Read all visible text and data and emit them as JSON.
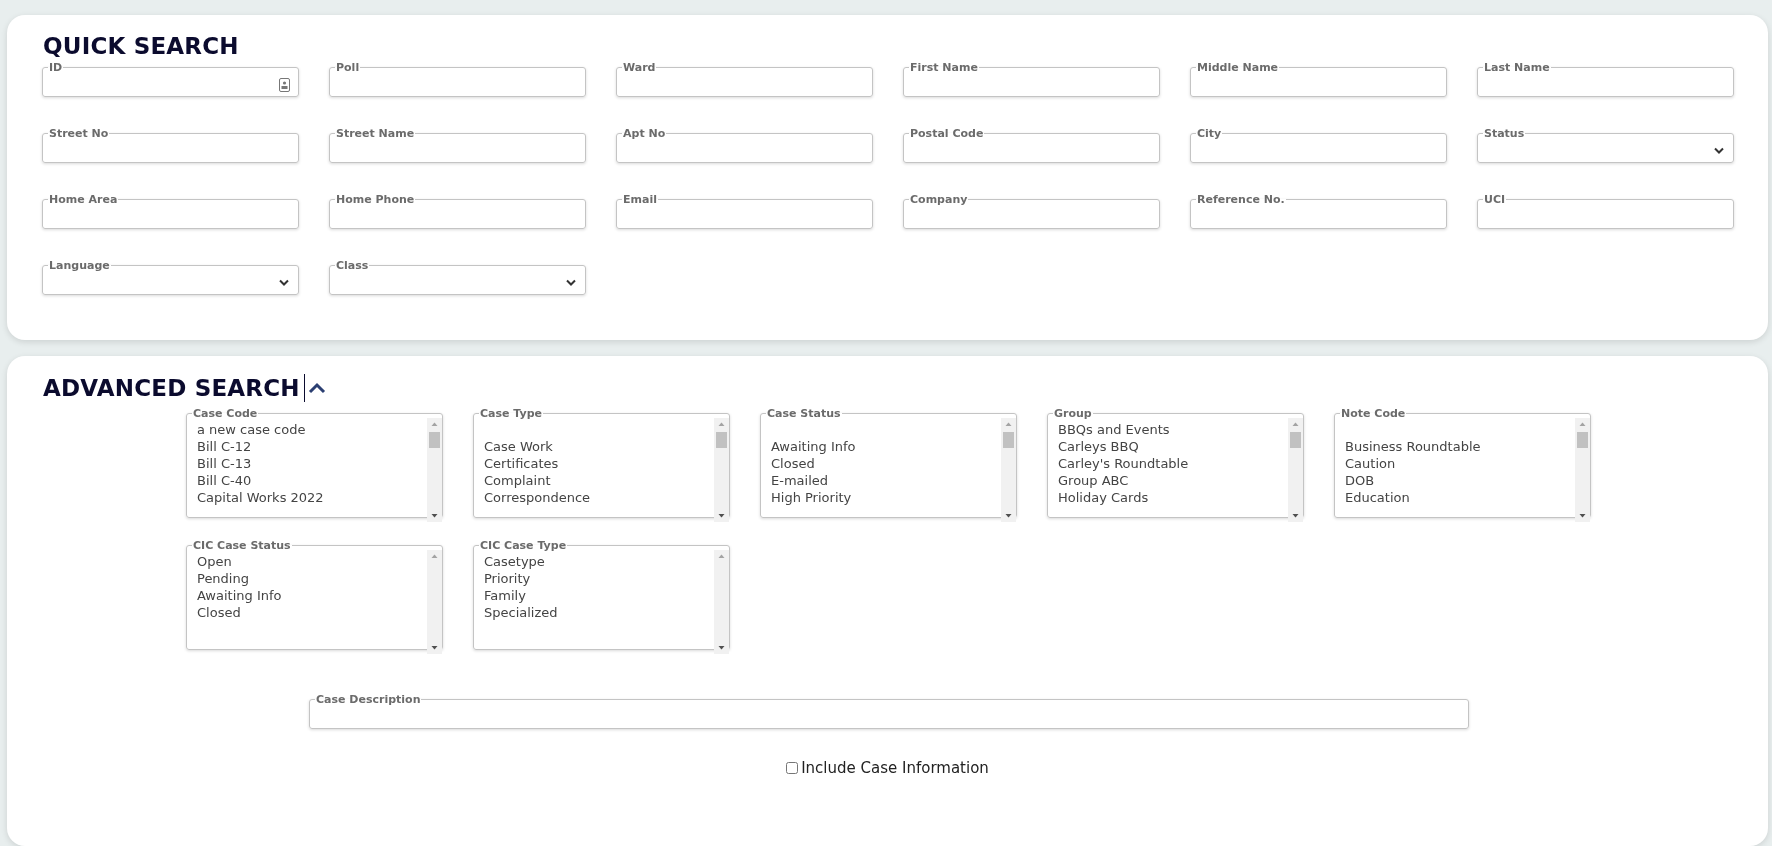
{
  "quick_search": {
    "title": "QUICK SEARCH",
    "fields": [
      {
        "label": "ID",
        "kind": "text",
        "icon": true
      },
      {
        "label": "Poll",
        "kind": "text"
      },
      {
        "label": "Ward",
        "kind": "text"
      },
      {
        "label": "First Name",
        "kind": "text"
      },
      {
        "label": "Middle Name",
        "kind": "text"
      },
      {
        "label": "Last Name",
        "kind": "text"
      },
      {
        "label": "Street No",
        "kind": "text"
      },
      {
        "label": "Street Name",
        "kind": "text"
      },
      {
        "label": "Apt No",
        "kind": "text"
      },
      {
        "label": "Postal Code",
        "kind": "text"
      },
      {
        "label": "City",
        "kind": "text"
      },
      {
        "label": "Status",
        "kind": "select"
      },
      {
        "label": "Home Area",
        "kind": "text"
      },
      {
        "label": "Home Phone",
        "kind": "text"
      },
      {
        "label": "Email",
        "kind": "text"
      },
      {
        "label": "Company",
        "kind": "text"
      },
      {
        "label": "Reference No.",
        "kind": "text"
      },
      {
        "label": "UCI",
        "kind": "text"
      },
      {
        "label": "Language",
        "kind": "select"
      },
      {
        "label": "Class",
        "kind": "select"
      }
    ]
  },
  "advanced_search": {
    "title": "ADVANCED SEARCH",
    "expanded": true,
    "lists": [
      {
        "label": "Case Code",
        "leading_blank": false,
        "options": [
          "a new case code",
          "Bill C-12",
          "Bill C-13",
          "Bill C-40",
          "Capital Works 2022"
        ]
      },
      {
        "label": "Case Type",
        "leading_blank": true,
        "options": [
          "Case Work",
          "Certificates",
          "Complaint",
          "Correspondence"
        ]
      },
      {
        "label": "Case Status",
        "leading_blank": true,
        "options": [
          "Awaiting Info",
          "Closed",
          "E-mailed",
          "High Priority"
        ]
      },
      {
        "label": "Group",
        "leading_blank": false,
        "options": [
          "BBQs and Events",
          "Carleys BBQ",
          "Carley's Roundtable",
          "Group ABC",
          "Holiday Cards"
        ]
      },
      {
        "label": "Note Code",
        "leading_blank": true,
        "options": [
          "Business Roundtable",
          "Caution",
          "DOB",
          "Education"
        ]
      },
      {
        "label": "CIC Case Status",
        "leading_blank": false,
        "options": [
          "Open",
          "Pending",
          "Awaiting Info",
          "Closed"
        ]
      },
      {
        "label": "CIC Case Type",
        "leading_blank": false,
        "options": [
          "Casetype",
          "Priority",
          "Family",
          "Specialized"
        ]
      }
    ],
    "case_description": {
      "label": "Case Description"
    },
    "include_case_information": {
      "label": "Include Case Information",
      "checked": false
    }
  }
}
